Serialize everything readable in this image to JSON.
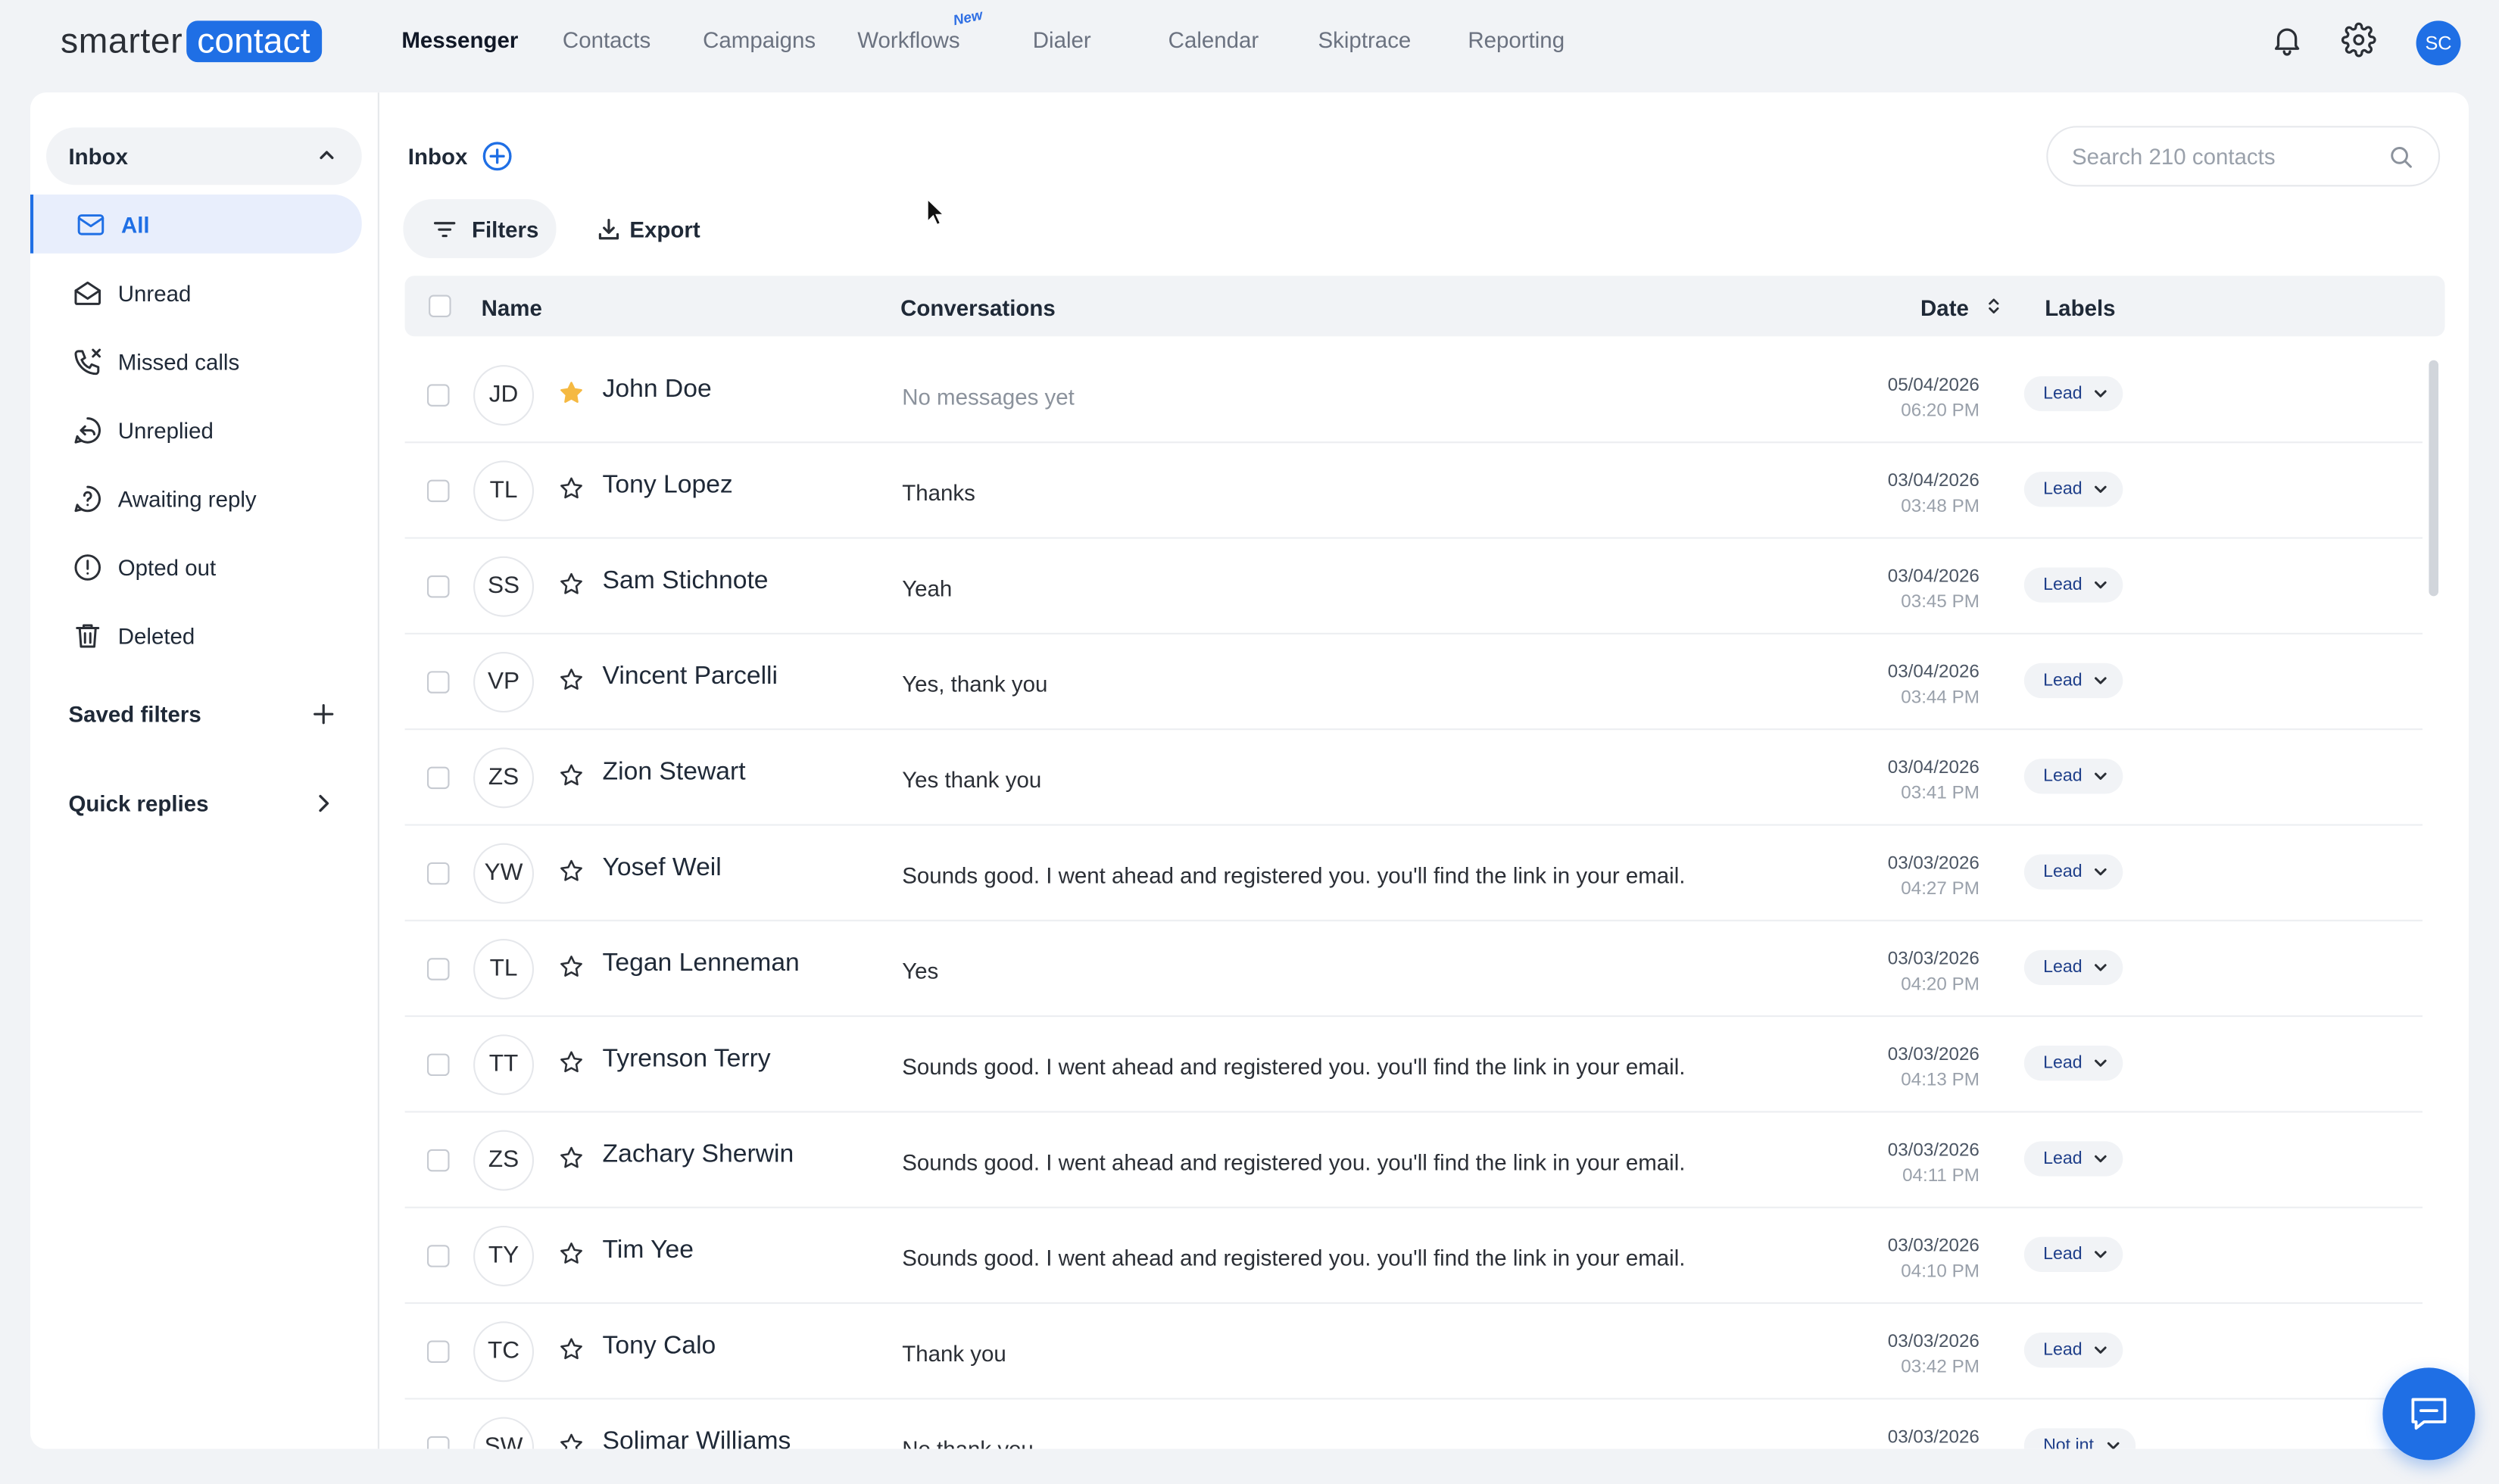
{
  "brand": {
    "logo_left": "smarter",
    "logo_right": "contact"
  },
  "nav": {
    "items": [
      "Messenger",
      "Contacts",
      "Campaigns",
      "Workflows",
      "Dialer",
      "Calendar",
      "Skiptrace",
      "Reporting"
    ],
    "active": "Messenger",
    "new_badge": "New"
  },
  "user": {
    "initials": "SC"
  },
  "sidebar": {
    "inbox_label": "Inbox",
    "items": [
      {
        "label": "All",
        "icon": "mail-icon"
      },
      {
        "label": "Unread",
        "icon": "envelope-open-icon"
      },
      {
        "label": "Missed calls",
        "icon": "missed-call-icon"
      },
      {
        "label": "Unreplied",
        "icon": "reply-icon"
      },
      {
        "label": "Awaiting reply",
        "icon": "question-bubble-icon"
      },
      {
        "label": "Opted out",
        "icon": "alert-circle-icon"
      },
      {
        "label": "Deleted",
        "icon": "trash-icon"
      }
    ],
    "saved_filters_label": "Saved filters",
    "quick_replies_label": "Quick replies"
  },
  "main": {
    "title": "Inbox",
    "search_placeholder": "Search 210 contacts",
    "filters_label": "Filters",
    "export_label": "Export",
    "columns": {
      "name": "Name",
      "conversations": "Conversations",
      "date": "Date",
      "labels": "Labels"
    }
  },
  "rows": [
    {
      "initials": "JD",
      "name": "John Doe",
      "starred": true,
      "message": "No messages yet",
      "muted": true,
      "date": "05/04/2026",
      "time": "06:20 PM",
      "label": "Lead"
    },
    {
      "initials": "TL",
      "name": "Tony Lopez",
      "starred": false,
      "message": "Thanks",
      "muted": false,
      "date": "03/04/2026",
      "time": "03:48 PM",
      "label": "Lead"
    },
    {
      "initials": "SS",
      "name": "Sam Stichnote",
      "starred": false,
      "message": "Yeah",
      "muted": false,
      "date": "03/04/2026",
      "time": "03:45 PM",
      "label": "Lead"
    },
    {
      "initials": "VP",
      "name": "Vincent Parcelli",
      "starred": false,
      "message": "Yes, thank you",
      "muted": false,
      "date": "03/04/2026",
      "time": "03:44 PM",
      "label": "Lead"
    },
    {
      "initials": "ZS",
      "name": "Zion Stewart",
      "starred": false,
      "message": "Yes thank you",
      "muted": false,
      "date": "03/04/2026",
      "time": "03:41 PM",
      "label": "Lead"
    },
    {
      "initials": "YW",
      "name": "Yosef Weil",
      "starred": false,
      "message": "Sounds good. I went ahead and registered you. you'll find the link in your email.",
      "muted": false,
      "date": "03/03/2026",
      "time": "04:27 PM",
      "label": "Lead"
    },
    {
      "initials": "TL",
      "name": "Tegan Lenneman",
      "starred": false,
      "message": "Yes",
      "muted": false,
      "date": "03/03/2026",
      "time": "04:20 PM",
      "label": "Lead"
    },
    {
      "initials": "TT",
      "name": "Tyrenson Terry",
      "starred": false,
      "message": "Sounds good. I went ahead and registered you. you'll find the link in your email.",
      "muted": false,
      "date": "03/03/2026",
      "time": "04:13 PM",
      "label": "Lead"
    },
    {
      "initials": "ZS",
      "name": "Zachary Sherwin",
      "starred": false,
      "message": "Sounds good. I went ahead and registered you. you'll find the link in your email.",
      "muted": false,
      "date": "03/03/2026",
      "time": "04:11 PM",
      "label": "Lead"
    },
    {
      "initials": "TY",
      "name": "Tim Yee",
      "starred": false,
      "message": "Sounds good. I went ahead and registered you. you'll find the link in your email.",
      "muted": false,
      "date": "03/03/2026",
      "time": "04:10 PM",
      "label": "Lead"
    },
    {
      "initials": "TC",
      "name": "Tony Calo",
      "starred": false,
      "message": "Thank you",
      "muted": false,
      "date": "03/03/2026",
      "time": "03:42 PM",
      "label": "Lead"
    },
    {
      "initials": "SW",
      "name": "Solimar Williams",
      "starred": false,
      "message": "No thank you",
      "muted": false,
      "date": "03/03/2026",
      "time": "",
      "label": "Not int"
    }
  ],
  "colors": {
    "accent": "#1f6fe5",
    "star_filled": "#f5b942",
    "background": "#f1f3f6"
  }
}
